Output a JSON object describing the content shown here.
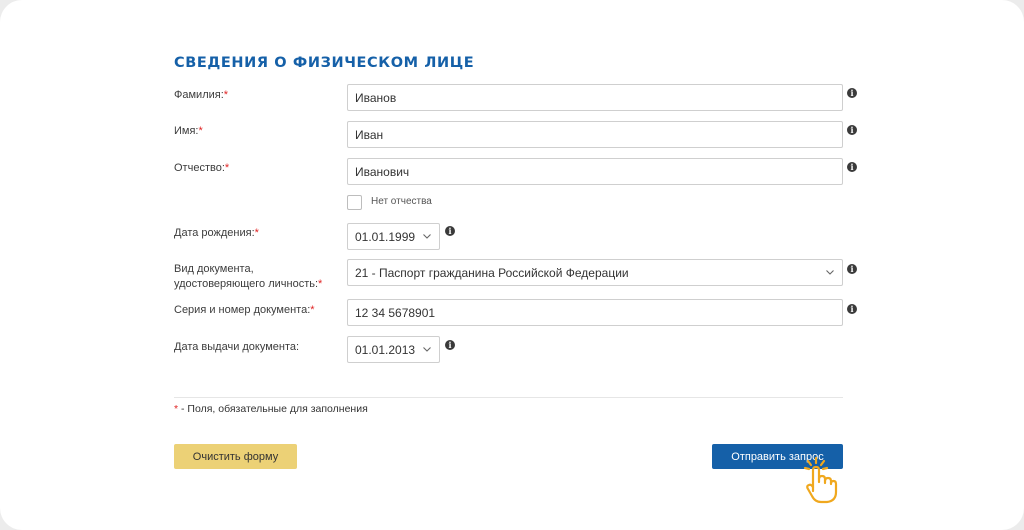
{
  "section": {
    "title": "СВЕДЕНИЯ О ФИЗИЧЕСКОМ ЛИЦЕ"
  },
  "fields": {
    "last_name": {
      "label": "Фамилия:",
      "required": "*",
      "value": "Иванов"
    },
    "first_name": {
      "label": "Имя:",
      "required": "*",
      "value": "Иван"
    },
    "patronymic": {
      "label": "Отчество:",
      "required": "*",
      "value": "Иванович"
    },
    "no_patronymic": {
      "label": "Нет отчества",
      "checked": false
    },
    "birth_date": {
      "label": "Дата рождения:",
      "required": "*",
      "value": "01.01.1999"
    },
    "doc_type": {
      "label_line1": "Вид документа,",
      "label_line2": "удостоверяющего личность:",
      "required": "*",
      "value": "21 - Паспорт гражданина Российской Федерации"
    },
    "doc_number": {
      "label": "Серия и номер документа:",
      "required": "*",
      "value": "12 34 5678901"
    },
    "issue_date": {
      "label": "Дата выдачи документа:",
      "value": "01.01.2013"
    }
  },
  "note": {
    "star": "*",
    "text": " - Поля, обязательные для заполнения"
  },
  "buttons": {
    "clear": "Очистить форму",
    "submit": "Отправить запрос"
  },
  "icons": {
    "info": "info-icon",
    "chevron": "chevron-down-icon",
    "pointer": "hand-pointer-icon"
  },
  "colors": {
    "accent": "#1560a8",
    "required": "#e02424",
    "clear_button": "#ecd176",
    "pointer": "#f0a81e"
  }
}
